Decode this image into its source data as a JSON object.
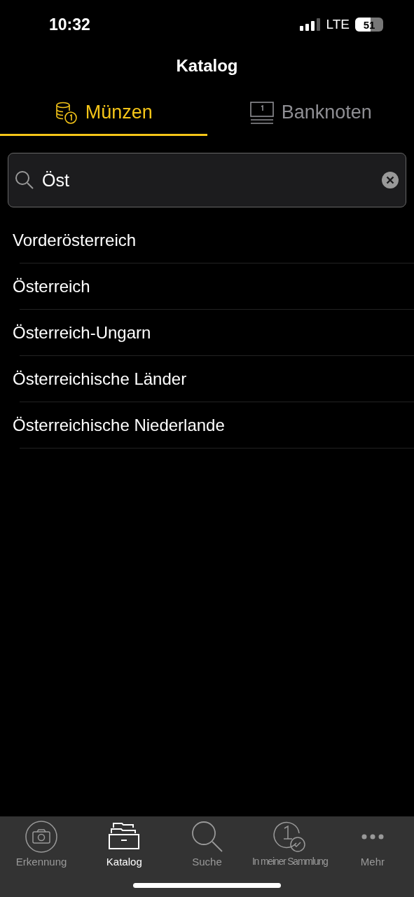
{
  "status_bar": {
    "time": "10:32",
    "network": "LTE",
    "battery": "51"
  },
  "title": "Katalog",
  "tabs": [
    {
      "label": "Münzen",
      "kind": "coins",
      "selected": true
    },
    {
      "label": "Banknoten",
      "kind": "notes",
      "selected": false
    }
  ],
  "search": {
    "value": "Öst"
  },
  "results": [
    "Vorderösterreich",
    "Österreich",
    "Österreich-Ungarn",
    "Österreichische Länder",
    "Österreichische Niederlande"
  ],
  "tab_bar": [
    {
      "label": "Erkennung",
      "kind": "camera",
      "selected": false
    },
    {
      "label": "Katalog",
      "kind": "catalog",
      "selected": true
    },
    {
      "label": "Suche",
      "kind": "search",
      "selected": false
    },
    {
      "label": "In meiner Sammlung",
      "kind": "collection",
      "selected": false
    },
    {
      "label": "Mehr",
      "kind": "more",
      "selected": false
    }
  ]
}
